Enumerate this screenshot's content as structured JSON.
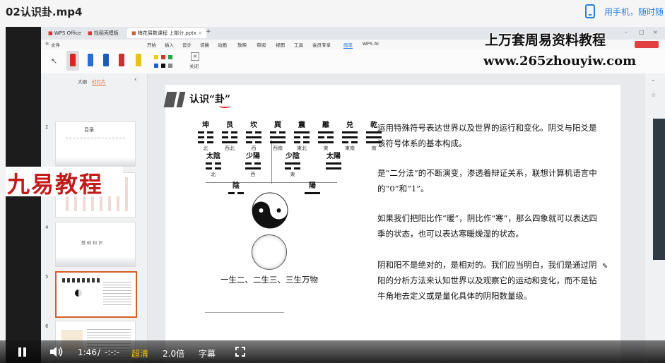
{
  "header": {
    "video_title": "02认识卦.mp4",
    "phone_text": "用手机，随时随"
  },
  "wps": {
    "tabs": [
      "WPS Office",
      "找稻壳模板",
      "梅花易数课程 上部分.pptx"
    ],
    "menu": [
      "文件",
      "开始",
      "插入",
      "设计",
      "切换",
      "动画",
      "放映",
      "审阅",
      "视图",
      "工具",
      "会员专享",
      "画笔",
      "WPS AI"
    ],
    "exit_label": "关闭",
    "panel_tabs": [
      "大纲",
      "幻灯片"
    ],
    "thumb_numbers": [
      "2",
      "3",
      "4",
      "5",
      "6"
    ],
    "thumb2_title": "目录",
    "thumb4_title": "基础知识"
  },
  "watermarks": {
    "top": "上万套周易资料教程",
    "url": "www.265zhouyiw.com",
    "left": "九易教程"
  },
  "slide": {
    "title": "认识“卦”",
    "trigrams": [
      {
        "name": "坤",
        "dir": "北",
        "lines": [
          "yin",
          "yin",
          "yin"
        ]
      },
      {
        "name": "艮",
        "dir": "西北",
        "lines": [
          "yang",
          "yin",
          "yin"
        ]
      },
      {
        "name": "坎",
        "dir": "西",
        "lines": [
          "yin",
          "yang",
          "yin"
        ]
      },
      {
        "name": "巽",
        "dir": "西南",
        "lines": [
          "yang",
          "yang",
          "yin"
        ]
      },
      {
        "name": "震",
        "dir": "東北",
        "lines": [
          "yin",
          "yin",
          "yang"
        ]
      },
      {
        "name": "離",
        "dir": "東",
        "lines": [
          "yang",
          "yin",
          "yang"
        ]
      },
      {
        "name": "兑",
        "dir": "東南",
        "lines": [
          "yin",
          "yang",
          "yang"
        ]
      },
      {
        "name": "乾",
        "dir": "南",
        "lines": [
          "yang",
          "yang",
          "yang"
        ]
      }
    ],
    "four_images": [
      {
        "name": "太陰",
        "dir": "北",
        "lines": [
          "yin",
          "yin"
        ]
      },
      {
        "name": "少陽",
        "dir": "西",
        "lines": [
          "yang",
          "yin"
        ]
      },
      {
        "name": "少陰",
        "dir": "東",
        "lines": [
          "yin",
          "yang"
        ]
      },
      {
        "name": "太陽",
        "dir": "",
        "lines": [
          "yang",
          "yang"
        ]
      }
    ],
    "two_forms": [
      {
        "name": "陰",
        "line": "yin"
      },
      {
        "name": "陽",
        "line": "yang"
      }
    ],
    "caption": "一生二、二生三、三生万物",
    "paragraphs": [
      "运用特殊符号表达世界以及世界的运行和变化。阴爻与阳爻是该符号体系的基本构成。",
      "是“二分法”的不断演变，渗透着辩证关系，联想计算机语言中的“0”和“1”。",
      "如果我们把阳比作“暖”，阴比作“寒”，那么四象就可以表达四季的状态，也可以表达寒暖燥湿的状态。",
      "阴和阳不是绝对的，是相对的。我们应当明白，我们是通过阴阳的分析方法来认知世界以及观察它的运动和变化，而不是钻牛角地去定义或是量化具体的阴阳数量级。"
    ]
  },
  "controls": {
    "time_current": "1:46",
    "time_sep": "/",
    "time_total": "-:-:-",
    "quality": "超清",
    "speed": "2.0倍",
    "subtitle": "字幕",
    "accent": "#f5c400"
  }
}
